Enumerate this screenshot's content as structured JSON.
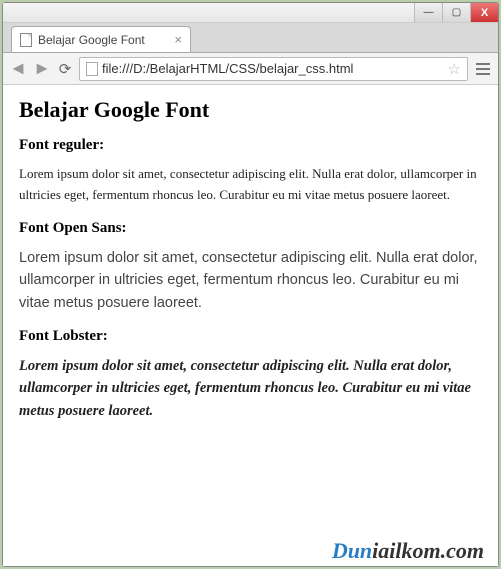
{
  "window": {
    "minimize": "—",
    "maximize": "▢",
    "close": "X"
  },
  "tab": {
    "title": "Belajar Google Font",
    "close": "×"
  },
  "addr": {
    "url": "file:///D:/BelajarHTML/CSS/belajar_css.html"
  },
  "page": {
    "h1": "Belajar Google Font",
    "h_reg": "Font reguler:",
    "p_reg": "Lorem ipsum dolor sit amet, consectetur adipiscing elit. Nulla erat dolor, ullamcorper in ultricies eget, fermentum rhoncus leo. Curabitur eu mi vitae metus posuere laoreet.",
    "h_sans": "Font Open Sans:",
    "p_sans": "Lorem ipsum dolor sit amet, consectetur adipiscing elit. Nulla erat dolor, ullamcorper in ultricies eget, fermentum rhoncus leo. Curabitur eu mi vitae metus posuere laoreet.",
    "h_lob": "Font Lobster:",
    "p_lob": "Lorem ipsum dolor sit amet, consectetur adipiscing elit. Nulla erat dolor, ullamcorper in ultricies eget, fermentum rhoncus leo. Curabitur eu mi vitae metus posuere laoreet."
  },
  "watermark": {
    "dun": "Dun",
    "rest": "iailkom.com"
  }
}
